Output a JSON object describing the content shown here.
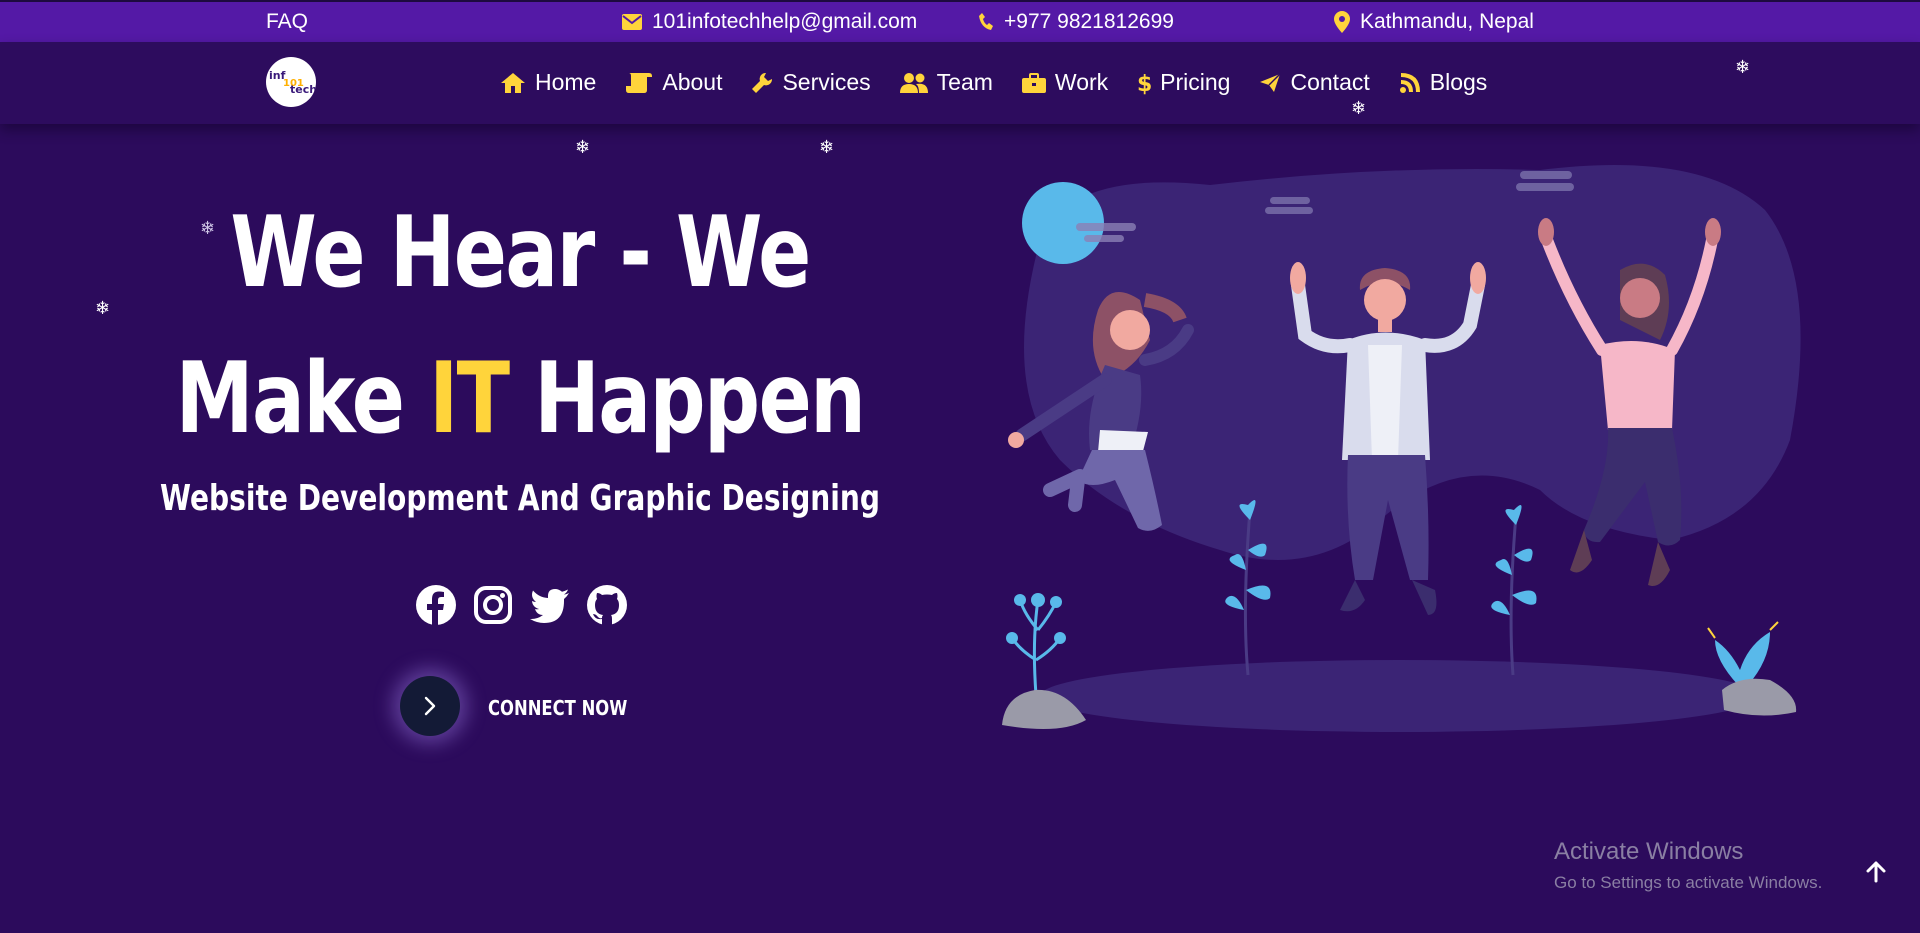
{
  "topbar": {
    "faq": "FAQ",
    "email": "101infotechhelp@gmail.com",
    "phone": "+977 9821812699",
    "location": "Kathmandu, Nepal"
  },
  "logo": {
    "text_line1": "inf",
    "text_line2": "101",
    "text_line3": "tech"
  },
  "nav": {
    "items": [
      {
        "label": "Home",
        "icon": "home-icon"
      },
      {
        "label": "About",
        "icon": "scroll-icon"
      },
      {
        "label": "Services",
        "icon": "wrench-icon"
      },
      {
        "label": "Team",
        "icon": "users-icon"
      },
      {
        "label": "Work",
        "icon": "briefcase-icon"
      },
      {
        "label": "Pricing",
        "icon": "dollar-icon"
      },
      {
        "label": "Contact",
        "icon": "paper-plane-icon"
      },
      {
        "label": "Blogs",
        "icon": "blog-icon"
      }
    ]
  },
  "hero": {
    "line1": "We Hear - We",
    "line2_a": "Make ",
    "line2_hl": "IT",
    "line2_b": " Happen",
    "subtitle": "Website Development And Graphic Designing",
    "cta_label": "CONNECT NOW",
    "socials": [
      "facebook-icon",
      "instagram-icon",
      "twitter-icon",
      "github-icon"
    ]
  },
  "watermark": {
    "title": "Activate Windows",
    "subtitle": "Go to Settings to activate Windows."
  },
  "colors": {
    "background": "#2c0b5c",
    "topbar": "#5419a6",
    "accent": "#ffd43b",
    "illustration_blob": "#3b2475"
  }
}
